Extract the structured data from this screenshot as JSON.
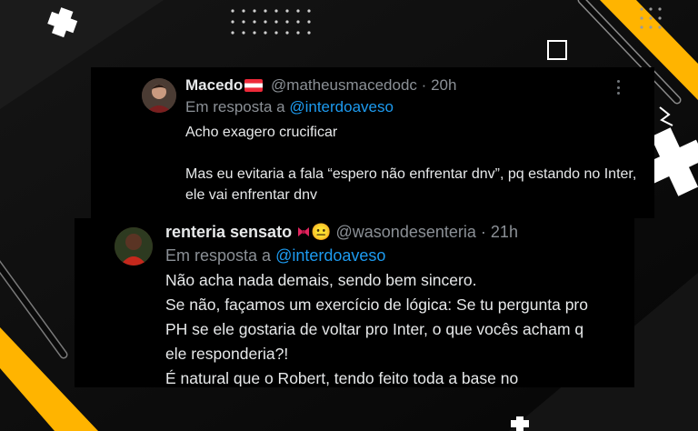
{
  "tweet1": {
    "name": "Macedo",
    "handle": "@matheusmacedodc",
    "separator": "·",
    "time": "20h",
    "reply_prefix": "Em resposta a",
    "reply_mention": "@interdoaveso",
    "paragraphs": [
      "Acho exagero crucificar",
      "Mas eu evitaria a fala “espero não enfrentar dnv”, pq estando no Inter, ele vai enfrentar dnv"
    ],
    "icons": {
      "flag": "austria-flag-icon",
      "more": "more-options-icon"
    }
  },
  "tweet2": {
    "name": "renteria sensato",
    "name_emoji": "😐",
    "handle": "@wasondesenteria",
    "separator": "·",
    "time": "21h",
    "reply_prefix": "Em resposta a",
    "reply_mention": "@interdoaveso",
    "lines": [
      "Não acha nada demais, sendo bem sincero.",
      "Se não, façamos um exercício de lógica: Se tu pergunta pro",
      "PH se ele gostaria de voltar pro Inter, o que vocês acham q",
      "ele responderia?!",
      "É natural que o Robert, tendo feito toda a base no"
    ],
    "icons": {
      "badge": "red-bow-icon"
    }
  },
  "colors": {
    "accent_yellow": "#ffb400",
    "link_blue": "#1d9bf0",
    "muted": "#8b9096",
    "text": "#e7e9ea"
  }
}
